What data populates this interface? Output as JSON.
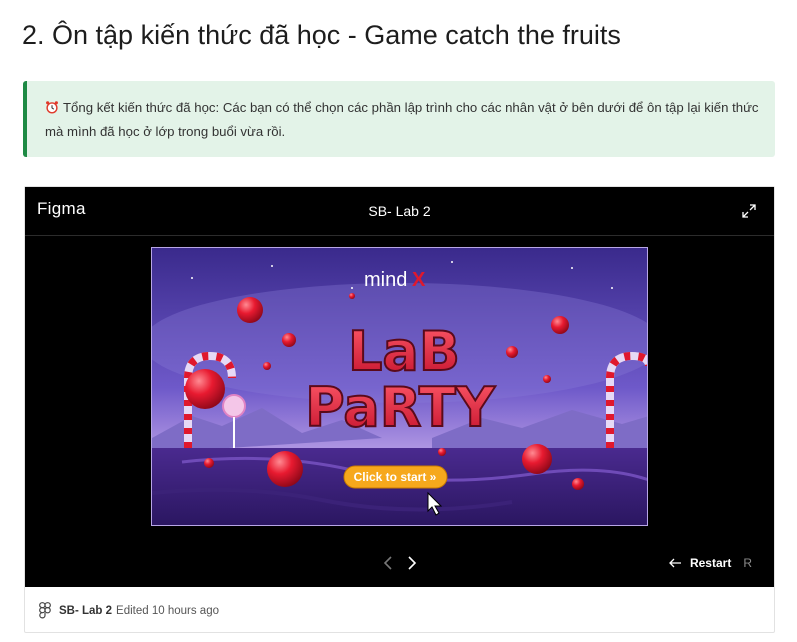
{
  "heading": "2. Ôn tập kiến thức đã học - Game catch the fruits",
  "callout": {
    "icon": "alarm-clock-icon",
    "text": "Tổng kết kiến thức đã học: Các bạn có thể chọn các phần lập trình cho các nhân vật ở bên dưới để ôn tập lại kiến thức mà mình đã học ở lớp trong buổi vừa rồi.",
    "accent_color": "#1e8a44",
    "background": "#e3f3e8"
  },
  "embed": {
    "brand": "Figma",
    "file_title": "SB- Lab 2",
    "restart_label": "Restart",
    "restart_key": "R",
    "footer_file": "SB- Lab 2",
    "footer_edited": "Edited 10 hours ago"
  },
  "game": {
    "logo_text": "mind",
    "logo_accent": "X",
    "title_line1": "LaB",
    "title_line2": "PaRTY",
    "start_button": "Click  to start »",
    "accent_color": "#e0182d",
    "button_color": "#f6a81c"
  }
}
